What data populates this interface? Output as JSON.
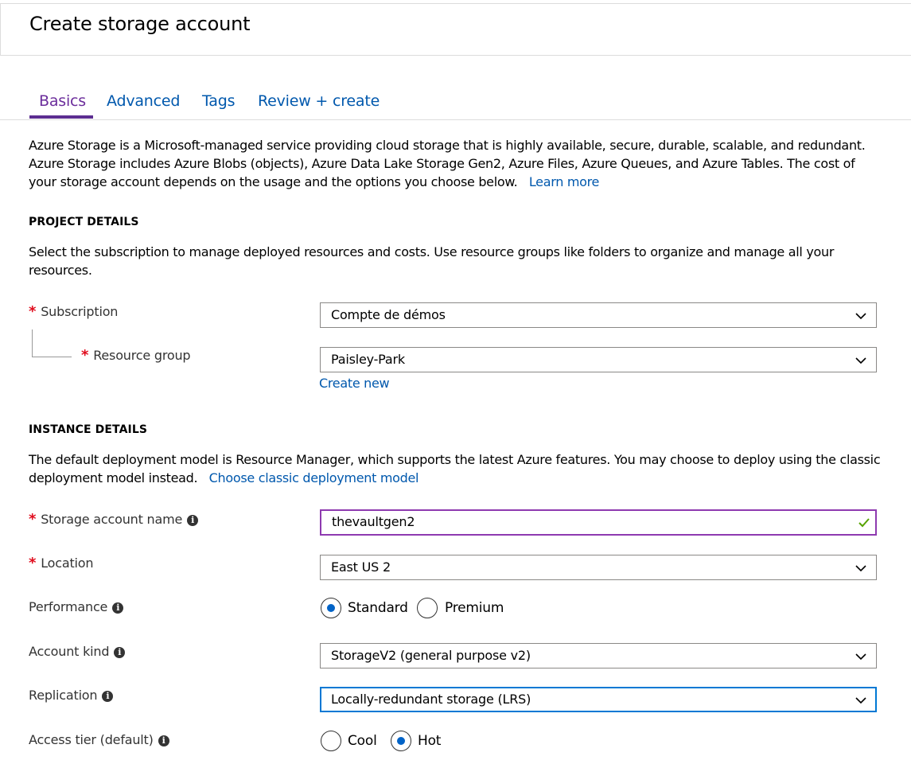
{
  "header": {
    "title": "Create storage account"
  },
  "tabs": [
    {
      "label": "Basics",
      "active": true
    },
    {
      "label": "Advanced",
      "active": false
    },
    {
      "label": "Tags",
      "active": false
    },
    {
      "label": "Review + create",
      "active": false
    }
  ],
  "intro": {
    "line1": "Azure Storage is a Microsoft-managed service providing cloud storage that is highly available, secure, durable, scalable, and redundant.",
    "line2": "Azure Storage includes Azure Blobs (objects), Azure Data Lake Storage Gen2, Azure Files, Azure Queues, and Azure Tables. The cost of",
    "line3": "your storage account depends on the usage and the options you choose below.",
    "learn_more": "Learn more"
  },
  "project": {
    "title": "PROJECT DETAILS",
    "desc_line1": "Select the subscription to manage deployed resources and costs. Use resource groups like folders to organize and manage all your",
    "desc_line2": "resources.",
    "subscription_label": "Subscription",
    "subscription_value": "Compte de démos",
    "resource_group_label": "Resource group",
    "resource_group_value": "Paisley-Park",
    "create_new": "Create new"
  },
  "instance": {
    "title": "INSTANCE DETAILS",
    "desc_line1": "The default deployment model is Resource Manager, which supports the latest Azure features. You may choose to deploy using the classic",
    "desc_line2": "deployment model instead.",
    "classic_link": "Choose classic deployment model",
    "name_label": "Storage account name",
    "name_value": "thevaultgen2",
    "location_label": "Location",
    "location_value": "East US 2",
    "performance_label": "Performance",
    "performance_options": [
      "Standard",
      "Premium"
    ],
    "performance_selected": "Standard",
    "kind_label": "Account kind",
    "kind_value": "StorageV2 (general purpose v2)",
    "replication_label": "Replication",
    "replication_value": "Locally-redundant storage (LRS)",
    "tier_label": "Access tier (default)",
    "tier_options": [
      "Cool",
      "Hot"
    ],
    "tier_selected": "Hot"
  },
  "colors": {
    "link": "#0058ad",
    "active_tab": "#6b2d9b",
    "required": "#e00b1c",
    "radio_fill": "#0063c7",
    "valid_check": "#57a300",
    "input_focus": "#8e3ab0"
  },
  "icons": [
    "chevron-down-icon",
    "info-icon",
    "checkmark-icon"
  ]
}
